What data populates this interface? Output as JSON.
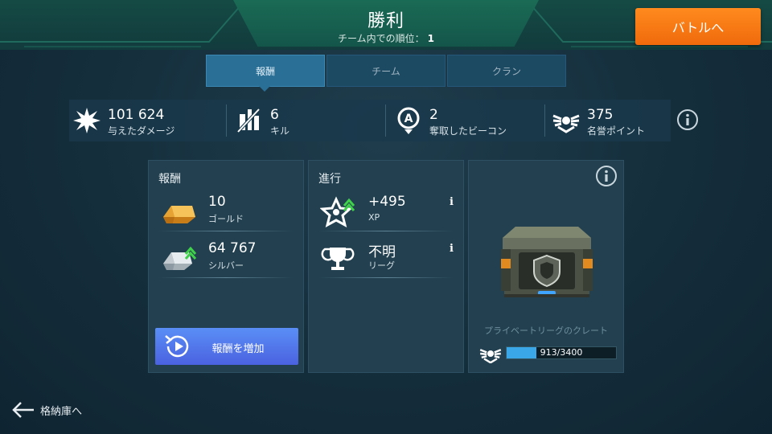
{
  "header": {
    "title": "勝利",
    "subtitle": "チーム内での順位：",
    "rank": "1",
    "battle_button": "バトルへ"
  },
  "tabs": [
    {
      "label": "報酬",
      "active": true
    },
    {
      "label": "チーム",
      "active": false
    },
    {
      "label": "クラン",
      "active": false
    }
  ],
  "stats": [
    {
      "icon": "explosion-icon",
      "value": "101 624",
      "label": "与えたダメージ"
    },
    {
      "icon": "kill-icon",
      "value": "6",
      "label": "キル"
    },
    {
      "icon": "beacon-icon",
      "value": "2",
      "label": "奪取したビーコン"
    },
    {
      "icon": "honor-icon",
      "value": "375",
      "label": "名誉ポイント"
    }
  ],
  "rewards": {
    "title": "報酬",
    "items": [
      {
        "icon": "gold-bar-icon",
        "value": "10",
        "label": "ゴールド"
      },
      {
        "icon": "silver-bar-icon",
        "value": "64 767",
        "label": "シルバー"
      }
    ],
    "add_button": "報酬を増加"
  },
  "progress": {
    "title": "進行",
    "items": [
      {
        "icon": "xp-star-icon",
        "value": "+495",
        "label": "XP"
      },
      {
        "icon": "trophy-icon",
        "value": "不明",
        "label": "リーグ"
      }
    ]
  },
  "crate": {
    "caption": "プライベートリーグのクレート",
    "progress_text": "913/3400",
    "progress_fraction": 0.27
  },
  "footer": {
    "back_label": "格納庫へ"
  },
  "colors": {
    "accent_orange": "#f47a14",
    "tab_active": "#2a6f96",
    "add_button": "#4f74ea",
    "progress": "#39a7e8"
  }
}
